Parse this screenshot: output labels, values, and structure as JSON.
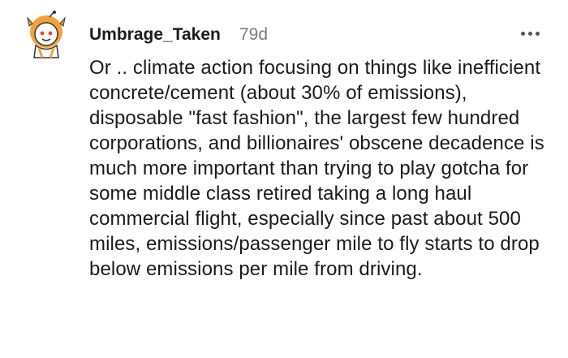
{
  "comment": {
    "author": "Umbrage_Taken",
    "age": "79d",
    "body": "Or .. climate action focusing on things like inefficient concrete/cement (about 30% of emissions), disposable \"fast fashion\", the largest few hundred corporations, and billionaires' obscene decadence is much more important than trying to play gotcha for some middle class retired taking a long haul commercial flight, especially since past about 500 miles, emissions/passenger mile to fly starts to drop below emissions per mile from driving.",
    "more_icon": "more-options-icon",
    "avatar_icon": "snoo-avatar-icon"
  },
  "colors": {
    "author": "#1c1c1c",
    "timestamp": "#7c7c7c",
    "body": "#1a1a1b",
    "avatar_accent": "#f2a23a"
  }
}
